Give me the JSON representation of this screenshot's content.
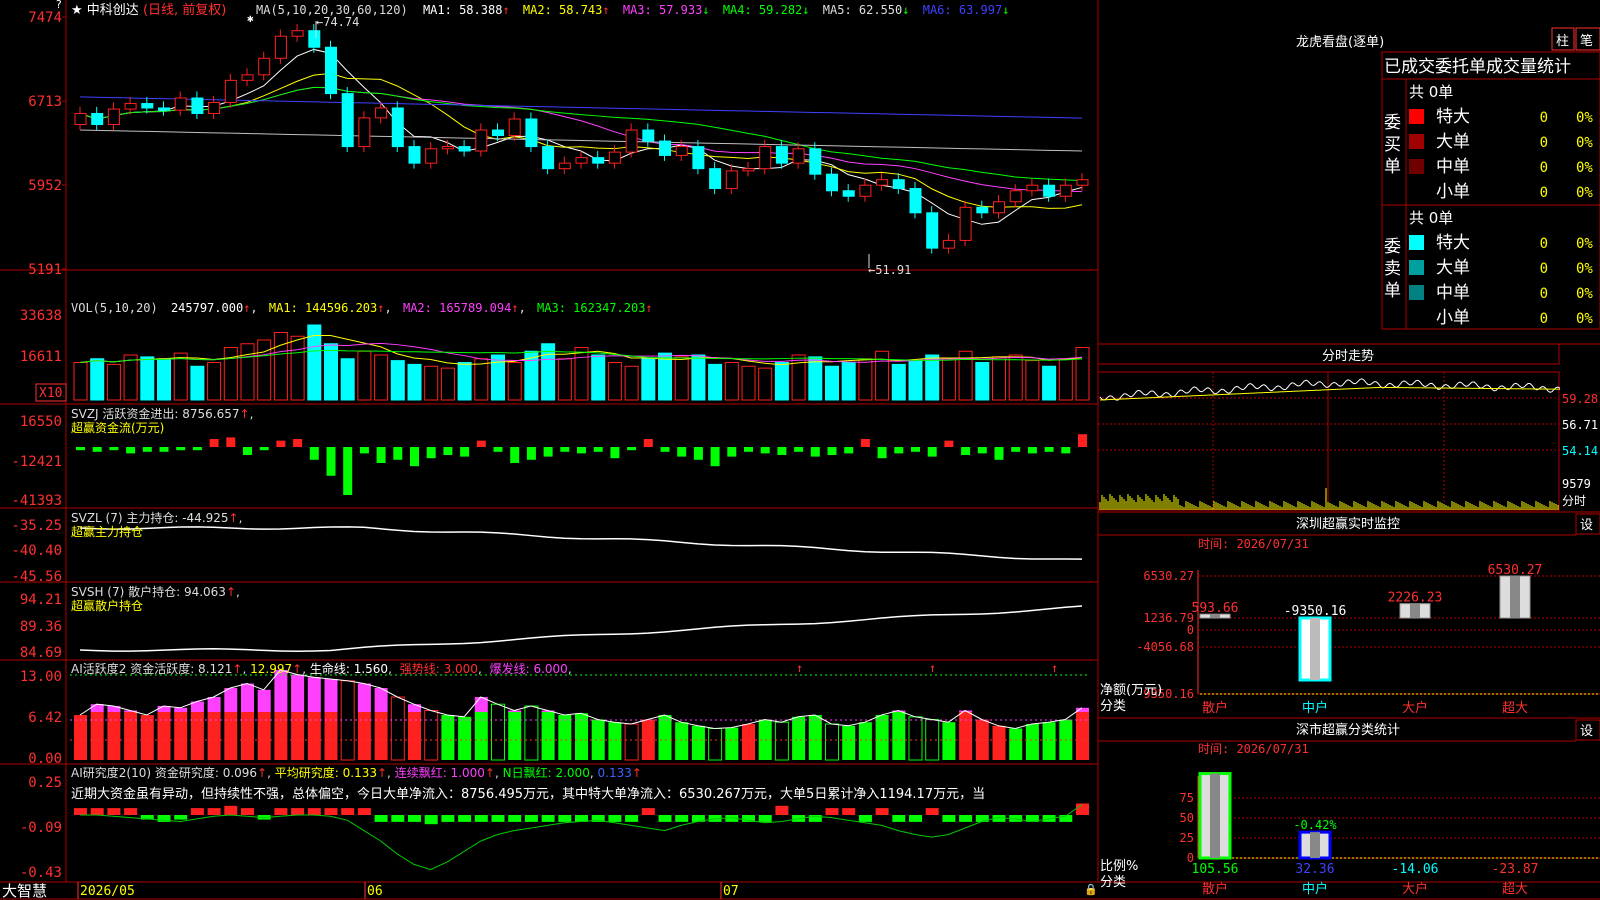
{
  "stock": {
    "name": "中科创达",
    "mode": "(日线, 前复权)"
  },
  "price_panel": {
    "ma_title": "MA(5,10,20,30,60,120)",
    "ma_items": [
      {
        "label": "MA1: 58.388",
        "arrow": "↑",
        "color": "#ffffff"
      },
      {
        "label": "MA2: 58.743",
        "arrow": "↑",
        "color": "#ffff00"
      },
      {
        "label": "MA3: 57.933",
        "arrow": "↓",
        "color": "#ff40ff"
      },
      {
        "label": "MA4: 59.282",
        "arrow": "↓",
        "color": "#00ff00"
      },
      {
        "label": "MA5: 62.550",
        "arrow": "↓",
        "color": "#c0c0c0"
      },
      {
        "label": "MA6: 63.997",
        "arrow": "↓",
        "color": "#4040ff"
      }
    ],
    "y_ticks": [
      "7474",
      "6713",
      "5952",
      "5191"
    ],
    "high_label": "74.74",
    "low_label": "51.91"
  },
  "vol_panel": {
    "title": "VOL(5,10,20)",
    "value": "245797.000",
    "ma1": "MA1: 144596.203",
    "ma2": "MA2: 165789.094",
    "ma3": "MA3: 162347.203",
    "y_ticks": [
      "33638",
      "16611"
    ],
    "unit": "X10"
  },
  "svzj_panel": {
    "title": "SVZJ  活跃资金进出: 8756.657",
    "subtitle": "超赢资金流(万元)",
    "y_ticks": [
      "16550",
      "-12421",
      "-41393"
    ]
  },
  "svzl_panel": {
    "title": "SVZL (7) 主力持仓: -44.925",
    "subtitle": "超赢主力持仓",
    "y_ticks": [
      "-35.25",
      "-40.40",
      "-45.56"
    ]
  },
  "svsh_panel": {
    "title": "SVSH (7) 散户持仓: 94.063",
    "subtitle": "超赢散户持仓",
    "y_ticks": [
      "94.21",
      "89.36",
      "84.69"
    ]
  },
  "ai_active_panel": {
    "title": "AI活跃度2 资金活跃度: 8.121",
    "v2": "12.997",
    "life": "生命线: 1.560",
    "strong": "强势线: 3.000",
    "burst": "爆发线: 6.000",
    "y_ticks": [
      "13.00",
      "6.42",
      "0.00"
    ]
  },
  "ai_research_panel": {
    "title": "AI研究度2(10) 资金研究度: 0.096",
    "avg": "平均研究度: 0.133",
    "streak": "连续飘红: 1.000",
    "nday": "N日飘红: 2.000",
    "last": "0.133",
    "commentary": "近期大资金虽有异动，但持续性不强，总体偏空，今日大单净流入：8756.495万元，其中特大单净流入：6530.267万元，大单5日累计净入1194.17万元，当",
    "y_ticks": [
      "0.25",
      "-0.09",
      "-0.43"
    ]
  },
  "bottom_bar": {
    "brand": "大智慧",
    "dates": [
      "2026/05",
      "06",
      "07"
    ]
  },
  "right_panel": {
    "dragon_title": "龙虎看盘(逐单)",
    "btn_bar": "柱",
    "btn_pen": "笔",
    "table_header": "已成交委托单成交量统计",
    "buy_label": "委买单",
    "sell_label": "委卖单",
    "buy_total": "共 0单",
    "sell_total": "共 0单",
    "buy_rows": [
      {
        "name": "特大",
        "count": "0",
        "pct": "0%",
        "color": "#ff0000"
      },
      {
        "name": "大单",
        "count": "0",
        "pct": "0%",
        "color": "#a00000"
      },
      {
        "name": "中单",
        "count": "0",
        "pct": "0%",
        "color": "#700000"
      },
      {
        "name": "小单",
        "count": "0",
        "pct": "0%",
        "color": "#000000"
      }
    ],
    "sell_rows": [
      {
        "name": "特大",
        "count": "0",
        "pct": "0%",
        "color": "#00ffff"
      },
      {
        "name": "大单",
        "count": "0",
        "pct": "0%",
        "color": "#00a0a0"
      },
      {
        "name": "中单",
        "count": "0",
        "pct": "0%",
        "color": "#008080"
      },
      {
        "name": "小单",
        "count": "0",
        "pct": "0%",
        "color": "#000000"
      }
    ],
    "intraday_title": "分时走势",
    "intraday_ticks": [
      "59.28",
      "56.71",
      "54.14",
      "9579"
    ],
    "intraday_unit": "分时",
    "sz_title": "深圳超赢实时监控",
    "sz_settings": "设",
    "sz_time": "时间: 2026/07/31",
    "sz_ticks": [
      "6530.27",
      "1236.79",
      "0",
      "-4056.68",
      "-9350.16"
    ],
    "sz_axis_label": "净额(万元)",
    "sz_cat_label": "分类",
    "sz_bars": [
      {
        "cat": "散户",
        "value": 593.66,
        "label": "593.66"
      },
      {
        "cat": "中户",
        "value": -9350.16,
        "label": "-9350.16"
      },
      {
        "cat": "大户",
        "value": 2226.23,
        "label": "2226.23"
      },
      {
        "cat": "超大",
        "value": 6530.27,
        "label": "6530.27"
      }
    ],
    "sm_title": "深市超赢分类统计",
    "sm_settings": "设",
    "sm_time": "时间: 2026/07/31",
    "sm_ticks": [
      "75",
      "50",
      "25",
      "0"
    ],
    "sm_axis_label": "比例%",
    "sm_cat_label": "分类",
    "sm_bars": [
      {
        "cat": "散户",
        "value": 105.56,
        "label": "105.56"
      },
      {
        "cat": "中户",
        "value": 32.36,
        "label": "32.36",
        "top_label": "-0.42%"
      },
      {
        "cat": "大户",
        "value": -14.06,
        "label": "-14.06"
      },
      {
        "cat": "超大",
        "value": -23.87,
        "label": "-23.87"
      }
    ]
  },
  "colors": {
    "up": "#ff2020",
    "down": "#00ffff",
    "grid": "#b00000",
    "green": "#00ff00",
    "magenta": "#ff40ff",
    "yellow": "#ffff00"
  }
}
